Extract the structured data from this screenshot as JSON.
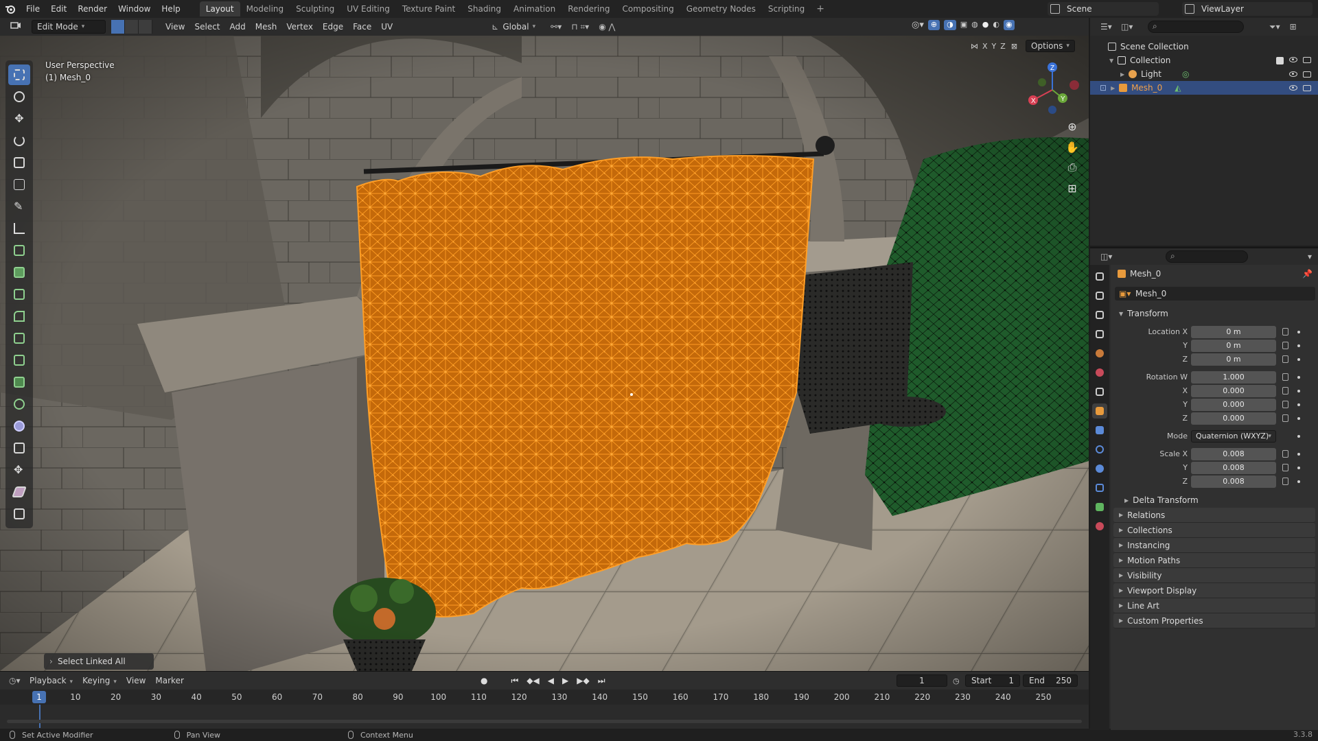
{
  "menu": [
    "File",
    "Edit",
    "Render",
    "Window",
    "Help"
  ],
  "workspaces": [
    "Layout",
    "Modeling",
    "Sculpting",
    "UV Editing",
    "Texture Paint",
    "Shading",
    "Animation",
    "Rendering",
    "Compositing",
    "Geometry Nodes",
    "Scripting"
  ],
  "active_workspace": "Layout",
  "scene_name": "Scene",
  "view_layer": "ViewLayer",
  "vp_header": {
    "mode": "Edit Mode",
    "menus": [
      "View",
      "Select",
      "Add",
      "Mesh",
      "Vertex",
      "Edge",
      "Face",
      "UV"
    ],
    "orientation": "Global",
    "options": "Options",
    "axes": [
      "X",
      "Y",
      "Z"
    ]
  },
  "viewport": {
    "view_name": "User Perspective",
    "object_label": "(1) Mesh_0",
    "last_operator": "Select Linked All"
  },
  "timeline": {
    "menus": [
      "Playback",
      "Keying",
      "View",
      "Marker"
    ],
    "current_frame": "1",
    "start_label": "Start",
    "start": "1",
    "end_label": "End",
    "end": "250",
    "ticks": [
      "10",
      "20",
      "30",
      "40",
      "50",
      "60",
      "70",
      "80",
      "90",
      "100",
      "110",
      "120",
      "130",
      "140",
      "150",
      "160",
      "170",
      "180",
      "190",
      "200",
      "210",
      "220",
      "230",
      "240",
      "250"
    ]
  },
  "status": {
    "left": "Set Active Modifier",
    "middle": "Pan View",
    "right": "Context Menu",
    "version": "3.3.8"
  },
  "outliner": {
    "scene_collection": "Scene Collection",
    "collection": "Collection",
    "light": "Light",
    "mesh": "Mesh_0"
  },
  "properties": {
    "object_name": "Mesh_0",
    "data_name": "Mesh_0",
    "transform": "Transform",
    "location": {
      "label": "Location X",
      "x": "0 m",
      "y": "0 m",
      "z": "0 m"
    },
    "rotation": {
      "label": "Rotation W",
      "w": "1.000",
      "x": "0.000",
      "y": "0.000",
      "z": "0.000"
    },
    "mode_label": "Mode",
    "mode_value": "Quaternion (WXYZ)",
    "scale": {
      "label": "Scale X",
      "x": "0.008",
      "y": "0.008",
      "z": "0.008"
    },
    "axis_y": "Y",
    "axis_z": "Z",
    "axis_x": "X",
    "delta_transform": "Delta Transform",
    "panels": [
      "Relations",
      "Collections",
      "Instancing",
      "Motion Paths",
      "Visibility",
      "Viewport Display",
      "Line Art",
      "Custom Properties"
    ]
  },
  "colors": {
    "accent": "#4772b3",
    "selection_orange": "#ff8a00",
    "mesh_active": "#f4a21a"
  }
}
